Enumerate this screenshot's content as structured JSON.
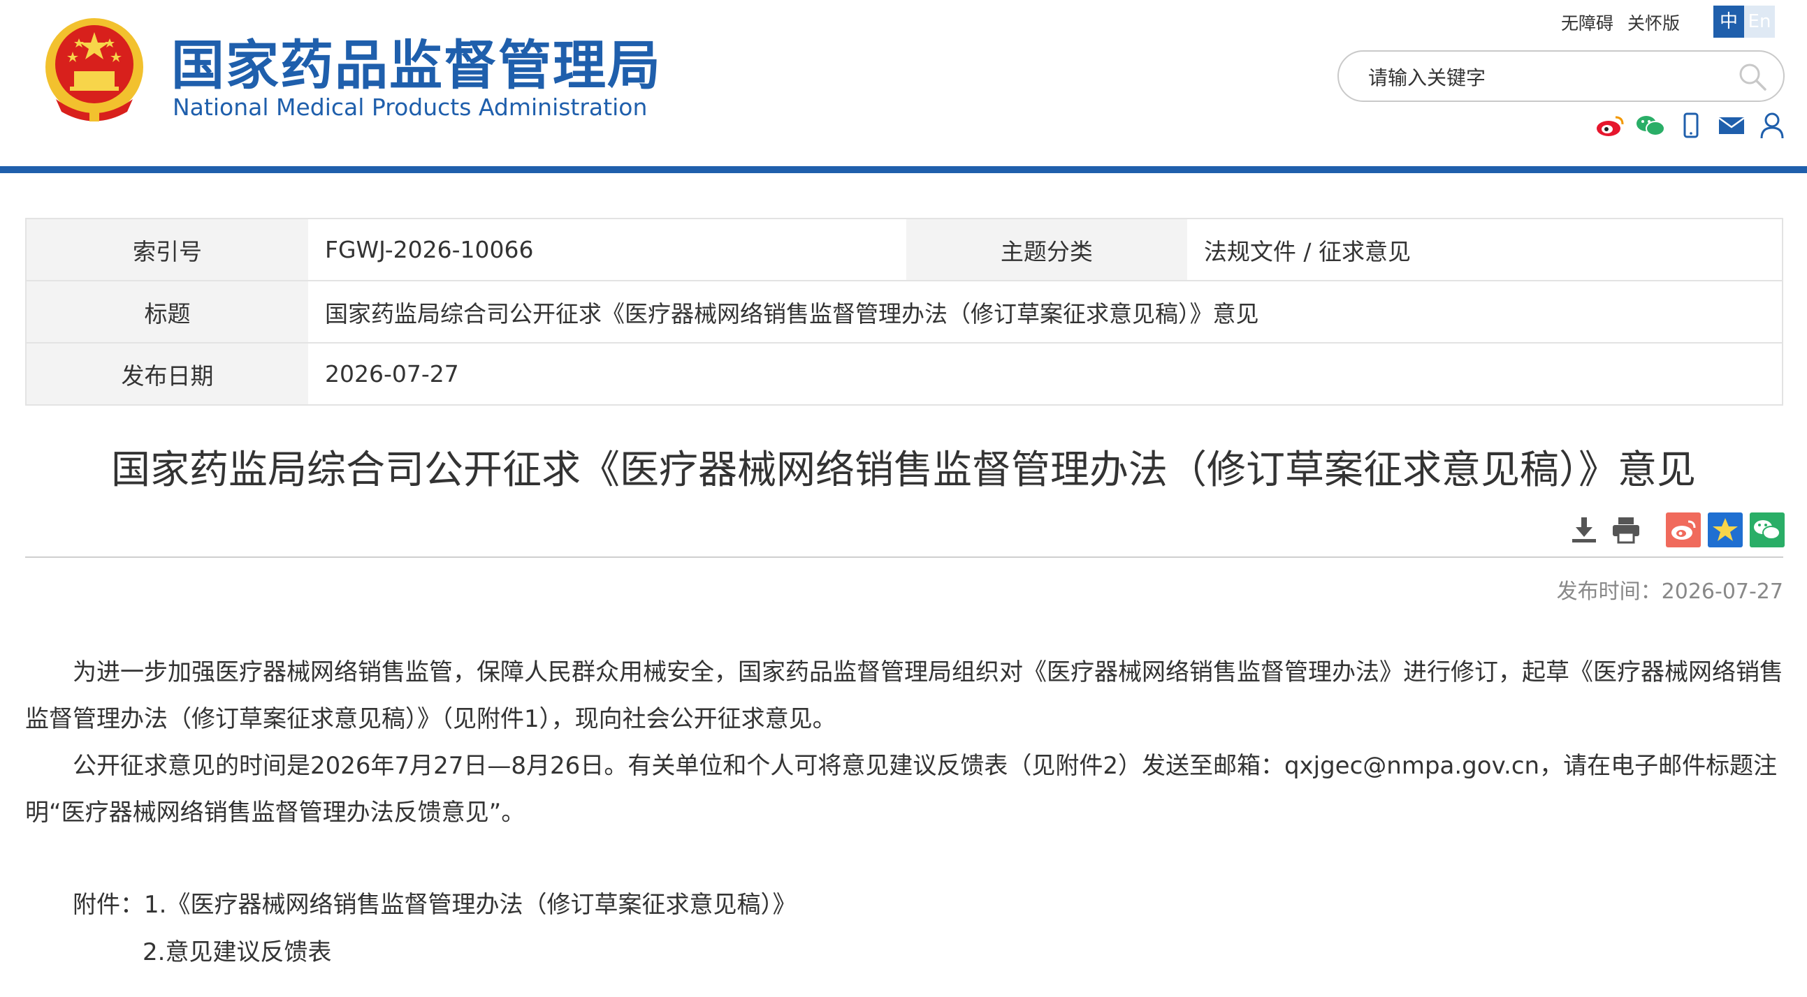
{
  "header": {
    "site_name_cn": "国家药品监督管理局",
    "site_name_en": "National Medical Products Administration",
    "accessibility_link": "无障碍",
    "care_link": "关怀版",
    "lang_zh": "中",
    "lang_en": "En",
    "search_placeholder": "请输入关键字",
    "social_icons": [
      "weibo-icon",
      "wechat-icon",
      "mobile-icon",
      "mail-icon",
      "user-icon"
    ],
    "brand_color": "#1f5fac"
  },
  "info_table": {
    "index_label": "索引号",
    "index_value": "FGWJ-2026-10066",
    "topic_label": "主题分类",
    "topic_value": "法规文件 / 征求意见",
    "title_label": "标题",
    "title_value": "国家药监局综合司公开征求《医疗器械网络销售监督管理办法（修订草案征求意见稿）》意见",
    "date_label": "发布日期",
    "date_value": "2026-07-27"
  },
  "article": {
    "title": "国家药监局综合司公开征求《医疗器械网络销售监督管理办法（修订草案征求意见稿）》意见",
    "tools": [
      "download-icon",
      "print-icon",
      "share-weibo-icon",
      "favorite-icon",
      "share-wechat-icon"
    ],
    "publish_time": "发布时间：2026-07-27",
    "para1": "为进一步加强医疗器械网络销售监管，保障人民群众用械安全，国家药品监督管理局组织对《医疗器械网络销售监督管理办法》进行修订，起草《医疗器械网络销售监督管理办法（修订草案征求意见稿）》（见附件1），现向社会公开征求意见。",
    "para2": "公开征求意见的时间是2026年7月27日—8月26日。有关单位和个人可将意见建议反馈表（见附件2）发送至邮箱：qxjgec@nmpa.gov.cn，请在电子邮件标题注明“医疗器械网络销售监督管理办法反馈意见”。",
    "attach_label": "附件：",
    "attach_1": "1.《医疗器械网络销售监督管理办法（修订草案征求意见稿）》",
    "attach_2": "2.意见建议反馈表"
  }
}
